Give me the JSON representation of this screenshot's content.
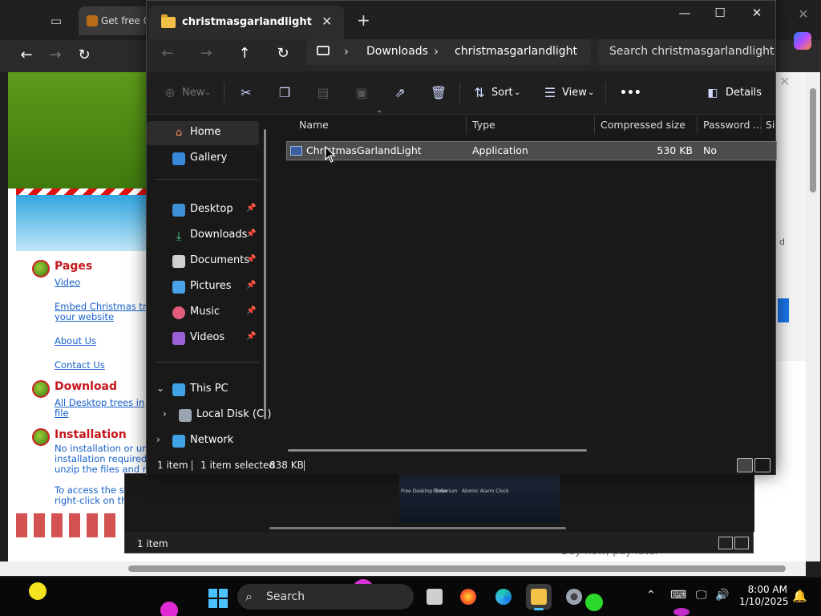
{
  "browser": {
    "tab_title": "Get free Cl",
    "site": {
      "sections": [
        {
          "heading": "Pages",
          "links": [
            "Video",
            "Embed Christmas tr",
            "your website",
            "About Us",
            "Contact Us"
          ]
        },
        {
          "heading": "Download",
          "links": [
            "All Desktop trees in",
            "file"
          ]
        },
        {
          "heading": "Installation",
          "text": [
            "No installation or un",
            "installation required",
            "unzip the files and r",
            "",
            "To access the settings,",
            "right-click on the tree."
          ]
        }
      ],
      "right_letter": "d",
      "footer_text": "Buy now, pay later"
    }
  },
  "explorer_back": {
    "status": "1 item",
    "thumb_labels": [
      "Free Desktop Timer",
      "Stellarium",
      "Atomic Alarm Clock"
    ]
  },
  "explorer": {
    "tab_title": "christmasgarlandlight",
    "breadcrumb": [
      "Downloads",
      "christmasgarlandlight"
    ],
    "search_placeholder": "Search christmasgarlandlight",
    "toolbar": {
      "new": "New",
      "sort": "Sort",
      "view": "View",
      "more": "•••",
      "details": "Details"
    },
    "nav": {
      "home": "Home",
      "gallery": "Gallery",
      "quick": [
        "Desktop",
        "Downloads",
        "Documents",
        "Pictures",
        "Music",
        "Videos"
      ],
      "this_pc": "This PC",
      "local_disk": "Local Disk (C:)",
      "network": "Network"
    },
    "columns": [
      "Name",
      "Type",
      "Compressed size",
      "Password ...",
      "Si"
    ],
    "files": [
      {
        "name": "ChristmasGarlandLight",
        "type": "Application",
        "compressed_size": "530 KB",
        "password": "No"
      }
    ],
    "status": {
      "items": "1 item",
      "selected": "1 item selected",
      "size": "838 KB"
    }
  },
  "taskbar": {
    "search_label": "Search",
    "clock_time": "8:00 AM",
    "clock_date": "1/10/2025"
  },
  "colors": {
    "accent": "#4cc2ff",
    "folder": "#f3c145",
    "link": "#1760c9",
    "site_heading": "#c4161c"
  }
}
